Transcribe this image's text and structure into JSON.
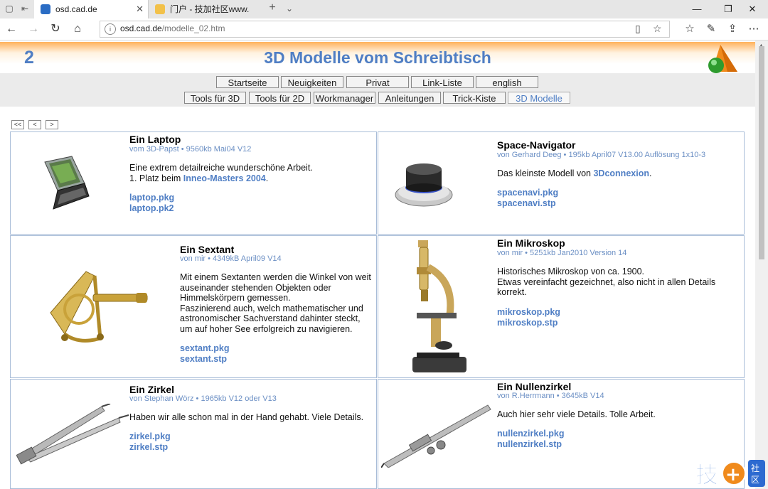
{
  "browser": {
    "tabs": [
      {
        "title": "osd.cad.de",
        "close": "✕"
      },
      {
        "title": "门户 - 技加社区www.addski",
        "close": ""
      }
    ],
    "url_host": "osd.cad.de",
    "url_path": "/modelle_02.htm"
  },
  "page": {
    "number": "2",
    "title": "3D Modelle vom Schreibtisch"
  },
  "nav": {
    "row1": [
      "Startseite",
      "Neuigkeiten",
      "Privat",
      "Link-Liste",
      "english"
    ],
    "row2": [
      "Tools für 3D",
      "Tools für 2D",
      "Workmanager",
      "Anleitungen",
      "Trick-Kiste",
      "3D Modelle"
    ]
  },
  "pager": [
    "<<",
    "<",
    ">"
  ],
  "models": [
    {
      "title": "Ein Laptop",
      "meta": "vom 3D-Papst • 9560kb Mai04 V12",
      "desc1": "Eine extrem detailreiche wunderschöne Arbeit.",
      "desc2_pre": "1. Platz beim ",
      "desc2_link": "Inneo-Masters 2004",
      "desc2_post": ".",
      "files": [
        "laptop.pkg",
        "laptop.pk2"
      ]
    },
    {
      "title": "Space-Navigator",
      "meta": "von Gerhard Deeg • 195kb April07 V13.00 Auflösung 1x10-3",
      "desc_pre": "Das kleinste Modell von ",
      "desc_link": "3Dconnexion",
      "desc_post": ".",
      "files": [
        "spacenavi.pkg",
        "spacenavi.stp"
      ]
    },
    {
      "title": "Ein Sextant",
      "meta": "von mir • 4349kB April09 V14",
      "desc": [
        "Mit einem Sextanten werden die Winkel von weit",
        "auseinander stehenden Objekten oder",
        "Himmelskörpern gemessen.",
        "Faszinierend auch, welch mathematischer und",
        "astronomischer Sachverstand dahinter steckt,",
        "um auf hoher See erfolgreich zu navigieren."
      ],
      "files": [
        "sextant.pkg",
        "sextant.stp"
      ]
    },
    {
      "title": "Ein Mikroskop",
      "meta": "von mir • 5251kb Jan2010 Version 14",
      "desc": [
        "Historisches Mikroskop von ca. 1900.",
        "Etwas vereinfacht gezeichnet, also nicht in allen Details",
        "korrekt."
      ],
      "files": [
        "mikroskop.pkg",
        "mikroskop.stp"
      ]
    },
    {
      "title": "Ein Zirkel",
      "meta": "von Stephan Wörz • 1965kb V12 oder V13",
      "desc": [
        "Haben wir alle schon mal in der Hand gehabt. Viele Details."
      ],
      "files": [
        "zirkel.pkg",
        "zirkel.stp"
      ]
    },
    {
      "title": "Ein Nullenzirkel",
      "meta": "von R.Herrmann • 3645kB V14",
      "desc": [
        "Auch hier sehr viele Details. Tolle Arbeit."
      ],
      "files": [
        "nullenzirkel.pkg",
        "nullenzirkel.stp"
      ]
    }
  ],
  "watermark": "技加社区",
  "colors": {
    "accent": "#4f7ec4",
    "header_orange": "#f39a2c",
    "card_border": "#a9bdd8"
  }
}
